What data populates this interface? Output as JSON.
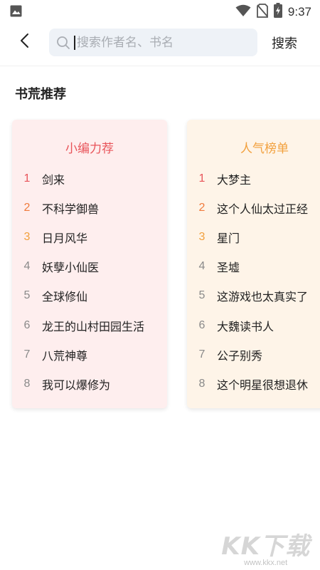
{
  "status_bar": {
    "time": "9:37",
    "icons": [
      "image-icon",
      "wifi-icon",
      "no-sim-icon",
      "battery-charging-icon"
    ]
  },
  "header": {
    "back_icon": "chevron-left-icon",
    "search_icon": "search-icon",
    "search_placeholder": "搜索作者名、书名",
    "search_value": "",
    "search_button_label": "搜索"
  },
  "section": {
    "title": "书荒推荐"
  },
  "cards": [
    {
      "title": "小编力荐",
      "accent": "#e8545a",
      "background": "#feeeee",
      "books": [
        {
          "rank": "1",
          "title": "剑来"
        },
        {
          "rank": "2",
          "title": "不科学御兽"
        },
        {
          "rank": "3",
          "title": "日月风华"
        },
        {
          "rank": "4",
          "title": "妖孽小仙医"
        },
        {
          "rank": "5",
          "title": "全球修仙"
        },
        {
          "rank": "6",
          "title": "龙王的山村田园生活"
        },
        {
          "rank": "7",
          "title": "八荒神尊"
        },
        {
          "rank": "8",
          "title": "我可以爆修为"
        }
      ]
    },
    {
      "title": "人气榜单",
      "accent": "#f2a03d",
      "background": "#fef4e8",
      "books": [
        {
          "rank": "1",
          "title": "大梦主"
        },
        {
          "rank": "2",
          "title": "这个人仙太过正经"
        },
        {
          "rank": "3",
          "title": "星门"
        },
        {
          "rank": "4",
          "title": "圣墟"
        },
        {
          "rank": "5",
          "title": "这游戏也太真实了"
        },
        {
          "rank": "6",
          "title": "大魏读书人"
        },
        {
          "rank": "7",
          "title": "公子别秀"
        },
        {
          "rank": "8",
          "title": "这个明星很想退休"
        }
      ]
    }
  ],
  "rank_colors": {
    "1": "#e8545a",
    "2": "#f07a3c",
    "3": "#f2a03d",
    "other": "#8a8a8a"
  },
  "watermark": {
    "logo": "KK下载",
    "url": "www.kkx.net"
  }
}
